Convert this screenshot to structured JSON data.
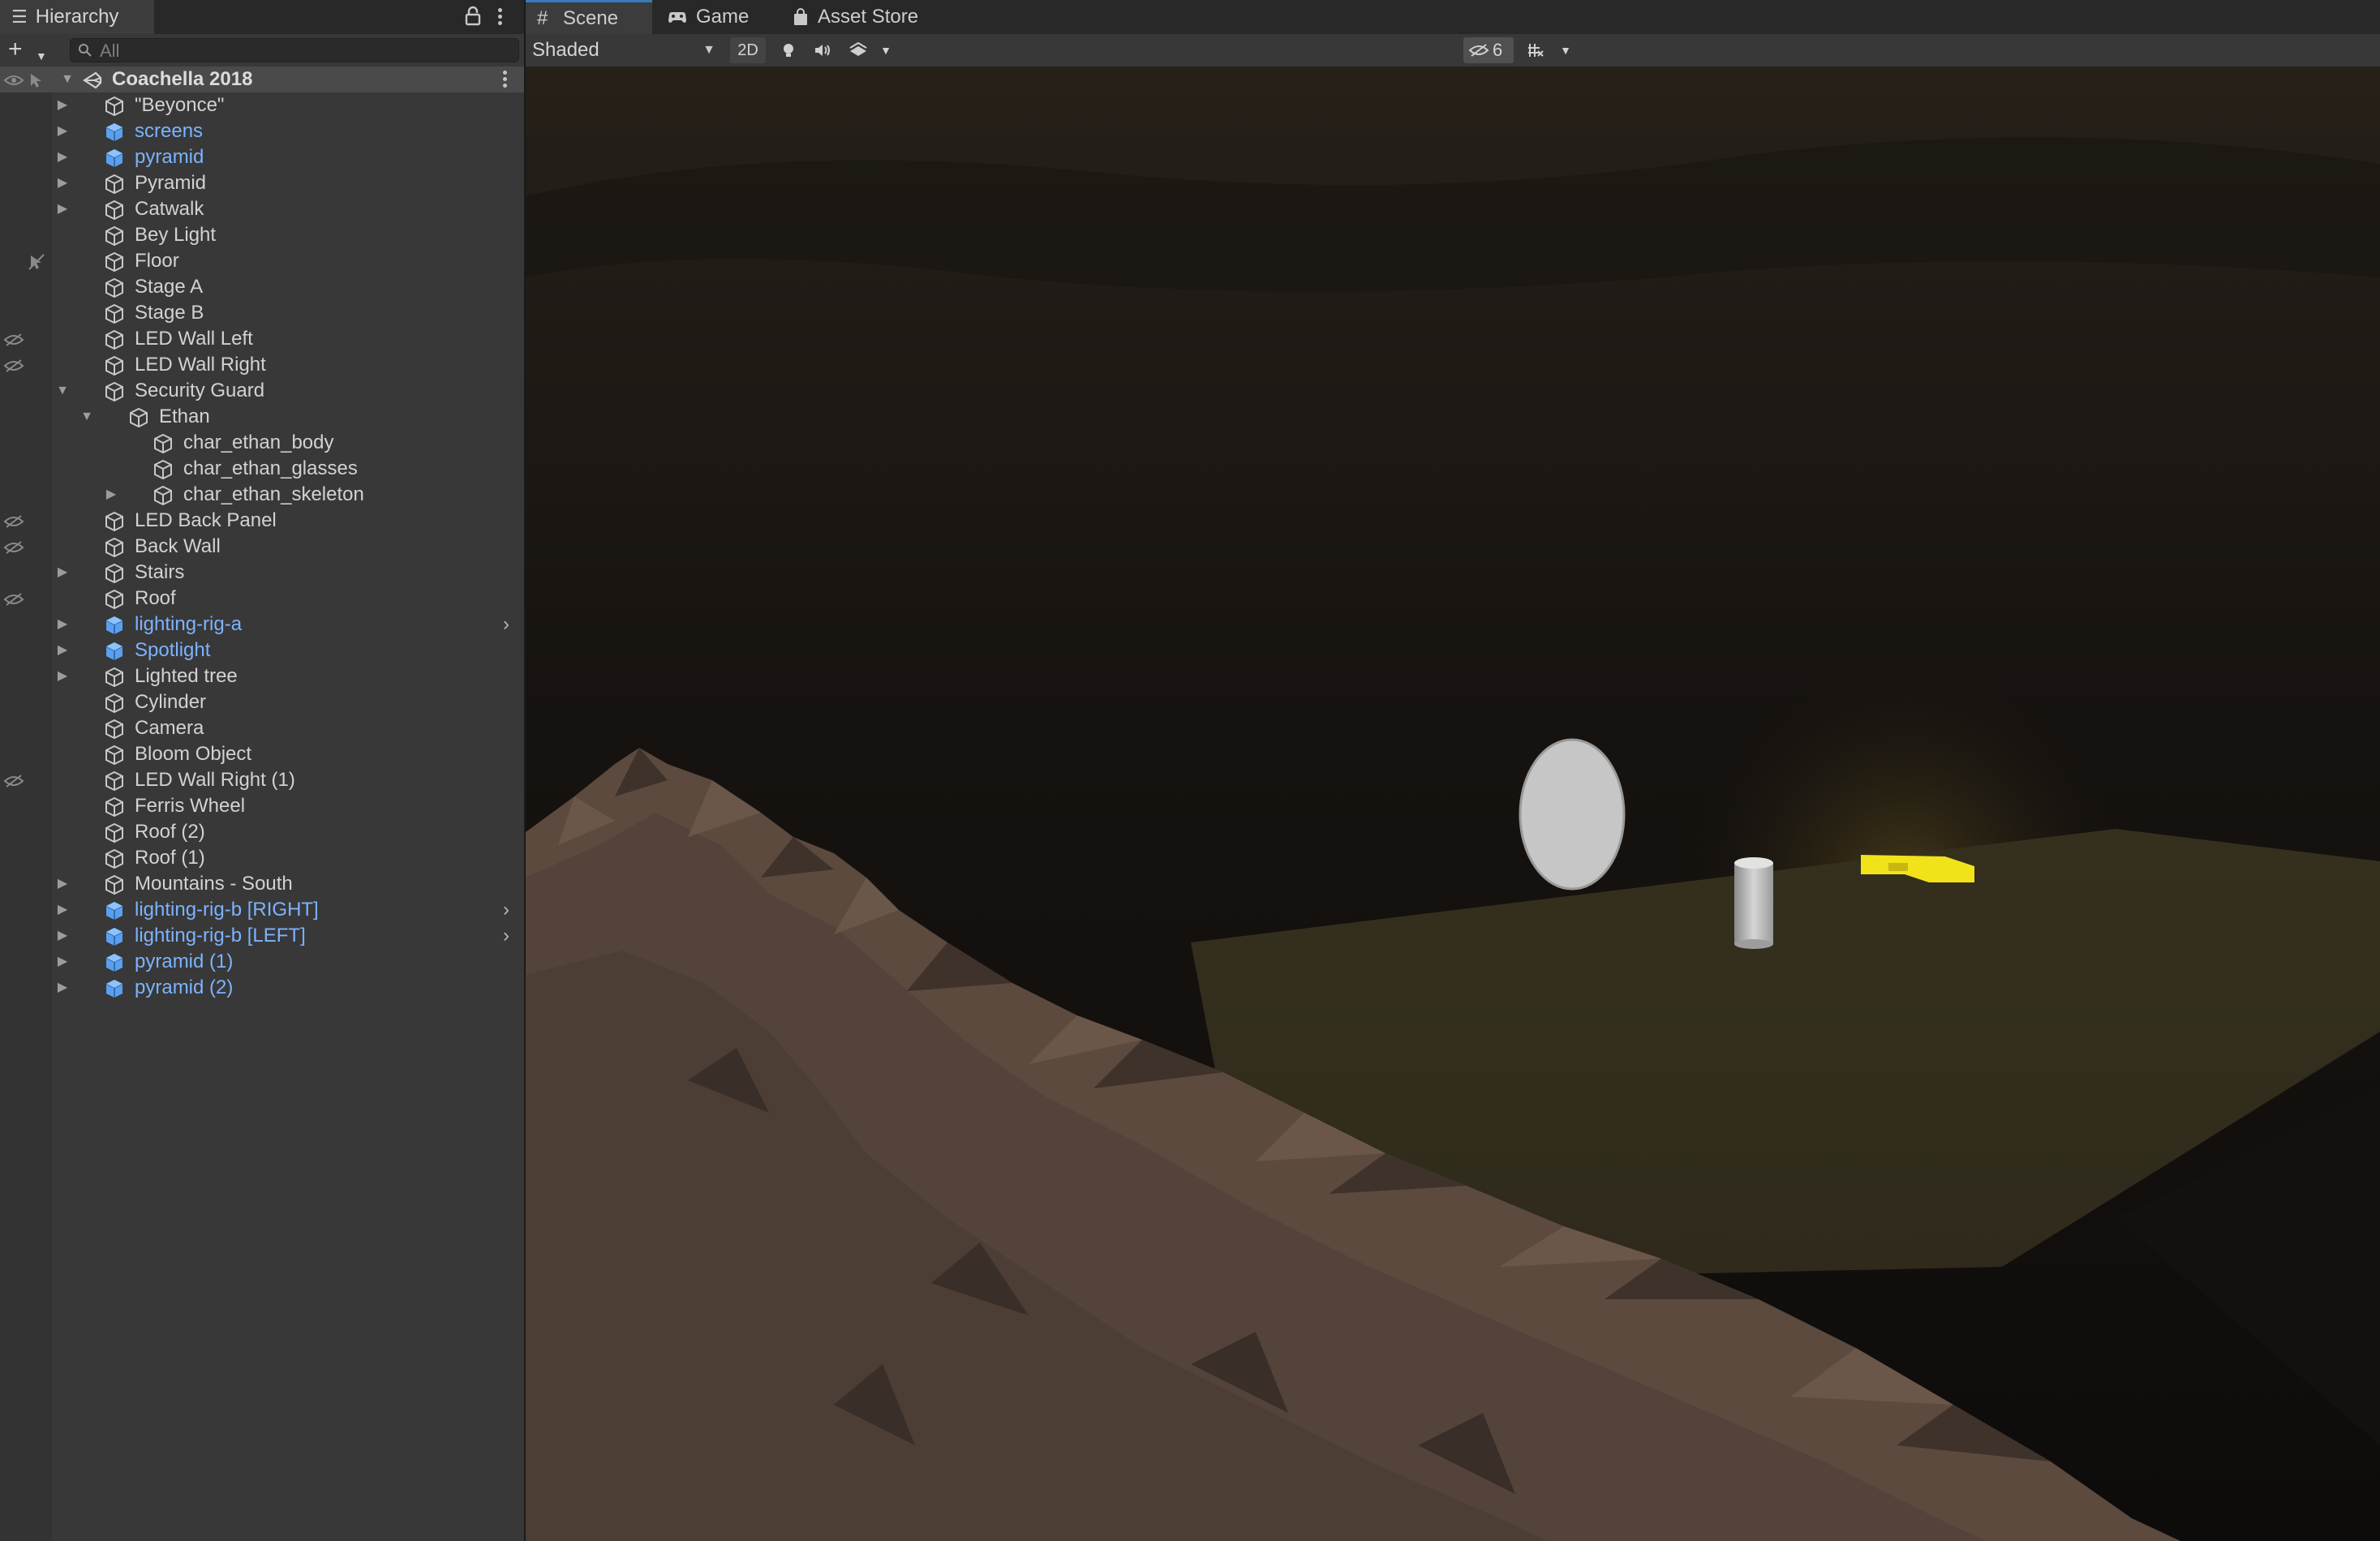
{
  "hierarchy": {
    "tab_label": "Hierarchy",
    "search_placeholder": "All",
    "root": {
      "label": "Coachella 2018"
    },
    "items": [
      {
        "label": "\"Beyonce\"",
        "depth": 1,
        "expandable": true,
        "expanded": false,
        "prefab": false,
        "hidden": false,
        "pick_disabled": false,
        "chevron": false
      },
      {
        "label": "screens",
        "depth": 1,
        "expandable": true,
        "expanded": false,
        "prefab": true,
        "hidden": false,
        "pick_disabled": false,
        "chevron": false
      },
      {
        "label": "pyramid",
        "depth": 1,
        "expandable": true,
        "expanded": false,
        "prefab": true,
        "hidden": false,
        "pick_disabled": false,
        "chevron": false
      },
      {
        "label": "Pyramid",
        "depth": 1,
        "expandable": true,
        "expanded": false,
        "prefab": false,
        "hidden": false,
        "pick_disabled": false,
        "chevron": false
      },
      {
        "label": "Catwalk",
        "depth": 1,
        "expandable": true,
        "expanded": false,
        "prefab": false,
        "hidden": false,
        "pick_disabled": false,
        "chevron": false
      },
      {
        "label": "Bey Light",
        "depth": 1,
        "expandable": false,
        "expanded": false,
        "prefab": false,
        "hidden": false,
        "pick_disabled": false,
        "chevron": false
      },
      {
        "label": "Floor",
        "depth": 1,
        "expandable": false,
        "expanded": false,
        "prefab": false,
        "hidden": false,
        "pick_disabled": true,
        "chevron": false
      },
      {
        "label": "Stage A",
        "depth": 1,
        "expandable": false,
        "expanded": false,
        "prefab": false,
        "hidden": false,
        "pick_disabled": false,
        "chevron": false
      },
      {
        "label": "Stage B",
        "depth": 1,
        "expandable": false,
        "expanded": false,
        "prefab": false,
        "hidden": false,
        "pick_disabled": false,
        "chevron": false
      },
      {
        "label": "LED Wall Left",
        "depth": 1,
        "expandable": false,
        "expanded": false,
        "prefab": false,
        "hidden": true,
        "pick_disabled": false,
        "chevron": false
      },
      {
        "label": "LED Wall Right",
        "depth": 1,
        "expandable": false,
        "expanded": false,
        "prefab": false,
        "hidden": true,
        "pick_disabled": false,
        "chevron": false
      },
      {
        "label": "Security Guard",
        "depth": 1,
        "expandable": true,
        "expanded": true,
        "prefab": false,
        "hidden": false,
        "pick_disabled": false,
        "chevron": false
      },
      {
        "label": "Ethan",
        "depth": 2,
        "expandable": true,
        "expanded": true,
        "prefab": false,
        "hidden": false,
        "pick_disabled": false,
        "chevron": false
      },
      {
        "label": "char_ethan_body",
        "depth": 3,
        "expandable": false,
        "expanded": false,
        "prefab": false,
        "hidden": false,
        "pick_disabled": false,
        "chevron": false
      },
      {
        "label": "char_ethan_glasses",
        "depth": 3,
        "expandable": false,
        "expanded": false,
        "prefab": false,
        "hidden": false,
        "pick_disabled": false,
        "chevron": false
      },
      {
        "label": "char_ethan_skeleton",
        "depth": 3,
        "expandable": true,
        "expanded": false,
        "prefab": false,
        "hidden": false,
        "pick_disabled": false,
        "chevron": false
      },
      {
        "label": "LED Back Panel",
        "depth": 1,
        "expandable": false,
        "expanded": false,
        "prefab": false,
        "hidden": true,
        "pick_disabled": false,
        "chevron": false
      },
      {
        "label": "Back Wall",
        "depth": 1,
        "expandable": false,
        "expanded": false,
        "prefab": false,
        "hidden": true,
        "pick_disabled": false,
        "chevron": false
      },
      {
        "label": "Stairs",
        "depth": 1,
        "expandable": true,
        "expanded": false,
        "prefab": false,
        "hidden": false,
        "pick_disabled": false,
        "chevron": false
      },
      {
        "label": "Roof",
        "depth": 1,
        "expandable": false,
        "expanded": false,
        "prefab": false,
        "hidden": true,
        "pick_disabled": false,
        "chevron": false
      },
      {
        "label": "lighting-rig-a",
        "depth": 1,
        "expandable": true,
        "expanded": false,
        "prefab": true,
        "hidden": false,
        "pick_disabled": false,
        "chevron": true
      },
      {
        "label": "Spotlight",
        "depth": 1,
        "expandable": true,
        "expanded": false,
        "prefab": true,
        "hidden": false,
        "pick_disabled": false,
        "chevron": false
      },
      {
        "label": "Lighted tree",
        "depth": 1,
        "expandable": true,
        "expanded": false,
        "prefab": false,
        "hidden": false,
        "pick_disabled": false,
        "chevron": false
      },
      {
        "label": "Cylinder",
        "depth": 1,
        "expandable": false,
        "expanded": false,
        "prefab": false,
        "hidden": false,
        "pick_disabled": false,
        "chevron": false
      },
      {
        "label": "Camera",
        "depth": 1,
        "expandable": false,
        "expanded": false,
        "prefab": false,
        "hidden": false,
        "pick_disabled": false,
        "chevron": false
      },
      {
        "label": "Bloom Object",
        "depth": 1,
        "expandable": false,
        "expanded": false,
        "prefab": false,
        "hidden": false,
        "pick_disabled": false,
        "chevron": false
      },
      {
        "label": "LED Wall Right (1)",
        "depth": 1,
        "expandable": false,
        "expanded": false,
        "prefab": false,
        "hidden": true,
        "pick_disabled": false,
        "chevron": false
      },
      {
        "label": "Ferris Wheel",
        "depth": 1,
        "expandable": false,
        "expanded": false,
        "prefab": false,
        "hidden": false,
        "pick_disabled": false,
        "chevron": false
      },
      {
        "label": "Roof (2)",
        "depth": 1,
        "expandable": false,
        "expanded": false,
        "prefab": false,
        "hidden": false,
        "pick_disabled": false,
        "chevron": false
      },
      {
        "label": "Roof (1)",
        "depth": 1,
        "expandable": false,
        "expanded": false,
        "prefab": false,
        "hidden": false,
        "pick_disabled": false,
        "chevron": false
      },
      {
        "label": "Mountains - South",
        "depth": 1,
        "expandable": true,
        "expanded": false,
        "prefab": false,
        "hidden": false,
        "pick_disabled": false,
        "chevron": false
      },
      {
        "label": "lighting-rig-b [RIGHT]",
        "depth": 1,
        "expandable": true,
        "expanded": false,
        "prefab": true,
        "hidden": false,
        "pick_disabled": false,
        "chevron": true
      },
      {
        "label": "lighting-rig-b [LEFT]",
        "depth": 1,
        "expandable": true,
        "expanded": false,
        "prefab": true,
        "hidden": false,
        "pick_disabled": false,
        "chevron": true
      },
      {
        "label": "pyramid (1)",
        "depth": 1,
        "expandable": true,
        "expanded": false,
        "prefab": true,
        "hidden": false,
        "pick_disabled": false,
        "chevron": false
      },
      {
        "label": "pyramid (2)",
        "depth": 1,
        "expandable": true,
        "expanded": false,
        "prefab": true,
        "hidden": false,
        "pick_disabled": false,
        "chevron": false
      }
    ]
  },
  "scene": {
    "tabs": [
      {
        "label": "Scene",
        "icon": "grid-icon",
        "active": true
      },
      {
        "label": "Game",
        "icon": "gamepad-icon",
        "active": false
      },
      {
        "label": "Asset Store",
        "icon": "shopping-bag-icon",
        "active": false
      }
    ],
    "toolbar": {
      "shading_mode": "Shaded",
      "mode_2d_label": "2D",
      "hidden_count": "6"
    }
  },
  "colors": {
    "prefab_text": "#7cb3ff",
    "panel_bg": "#383838",
    "active_tab_accent": "#3a79bb",
    "glow_object": "#f2e21a",
    "terrain": "#5c4a3f",
    "ground_plane": "#3b3621"
  }
}
